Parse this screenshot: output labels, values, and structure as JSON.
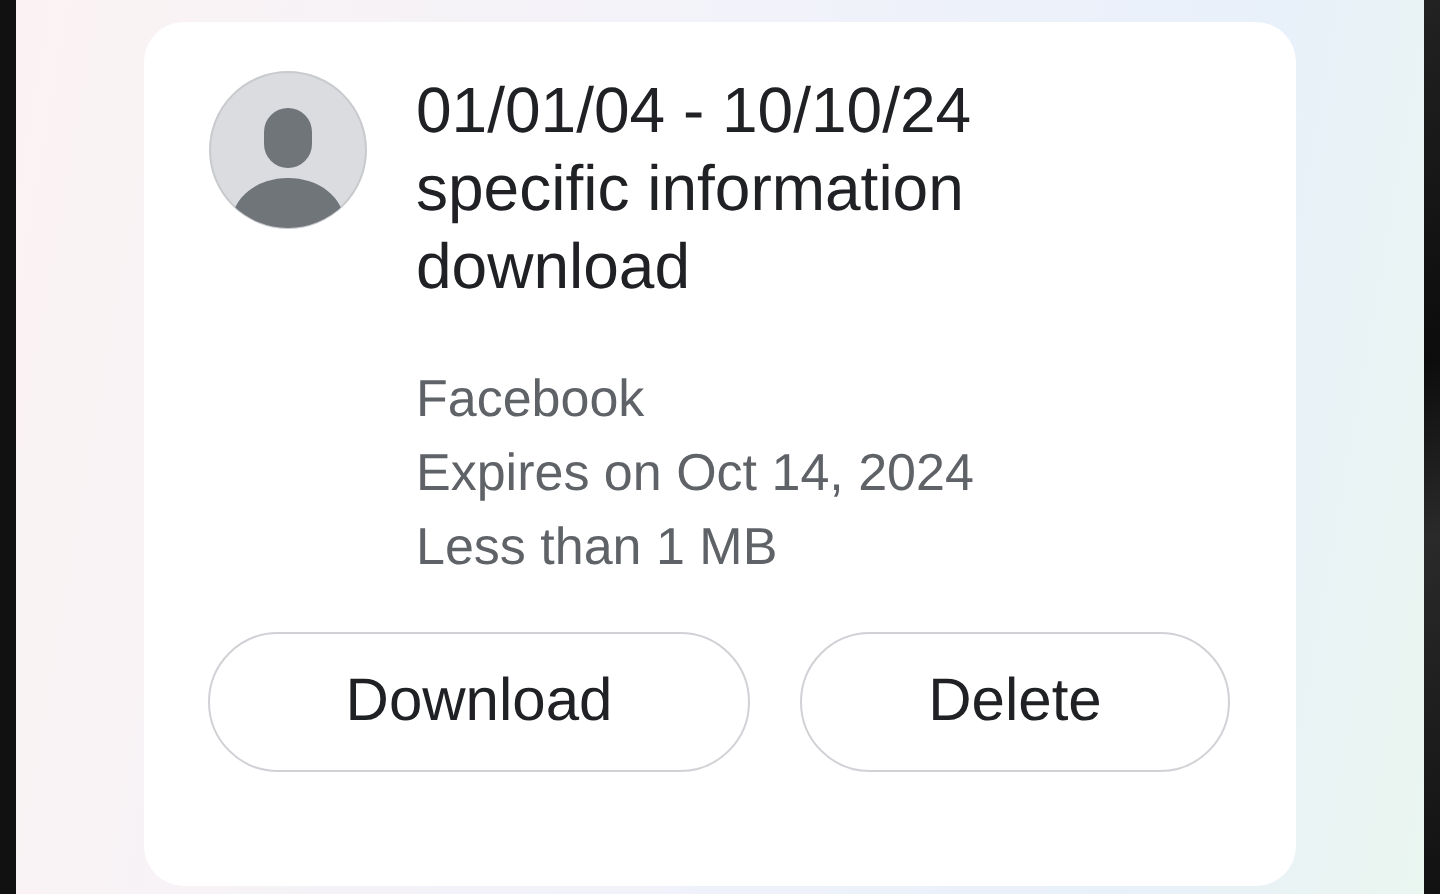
{
  "title": "01/01/04 - 10/10/24 specific information download",
  "details": [
    "Facebook",
    "Expires on Oct 14, 2024",
    "Less than 1 MB"
  ],
  "buttons": [
    "Download",
    "Delete"
  ]
}
